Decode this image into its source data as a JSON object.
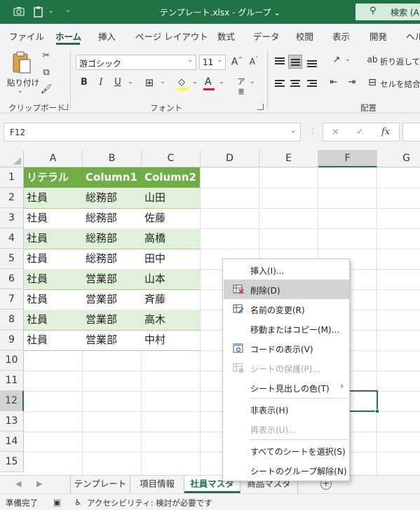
{
  "titlebar": {
    "title": "テンプレート.xlsx  -  グループ ⌄",
    "search_label": "検索 (A"
  },
  "ribbon": {
    "tabs": [
      "ファイル",
      "ホーム",
      "挿入",
      "ページ レイアウト",
      "数式",
      "データ",
      "校閲",
      "表示",
      "開発",
      "ヘル"
    ],
    "active_tab": "ホーム",
    "clipboard": {
      "paste_label": "貼り付け",
      "group_label": "クリップボード"
    },
    "font": {
      "name": "游ゴシック",
      "size": "11",
      "group_label": "フォント",
      "grow": "A^",
      "shrink": "Aˇ"
    },
    "alignment": {
      "wrap_label": "折り返して全",
      "merge_label": "セルを結合",
      "group_label": "配置"
    }
  },
  "formula_bar": {
    "name_box": "F12",
    "fx": "fx",
    "cancel": "×",
    "enter": "✓"
  },
  "grid": {
    "columns": [
      "A",
      "B",
      "C",
      "D",
      "E",
      "F",
      "G"
    ],
    "selected_column": "F",
    "rows": [
      "1",
      "2",
      "3",
      "4",
      "5",
      "6",
      "7",
      "8",
      "9",
      "10",
      "11",
      "12",
      "13",
      "14",
      "15"
    ],
    "selected_row": "12",
    "table": {
      "headers": [
        "リテラル",
        "Column1",
        "Column2"
      ],
      "rows": [
        [
          "社員",
          "総務部",
          "山田"
        ],
        [
          "社員",
          "総務部",
          "佐藤"
        ],
        [
          "社員",
          "総務部",
          "高橋"
        ],
        [
          "社員",
          "総務部",
          "田中"
        ],
        [
          "社員",
          "営業部",
          "山本"
        ],
        [
          "社員",
          "営業部",
          "斉藤"
        ],
        [
          "社員",
          "営業部",
          "高木"
        ],
        [
          "社員",
          "営業部",
          "中村"
        ]
      ],
      "header_color": "#70ad47",
      "band_color": "#e2efda"
    }
  },
  "sheets": {
    "tabs": [
      "テンプレート",
      "項目情報",
      "社員マスタ",
      "商品マスタ"
    ],
    "active": "社員マスタ",
    "add_label": "+"
  },
  "status": {
    "ready": "準備完了",
    "accessibility": "アクセシビリティ: 検討が必要です"
  },
  "context_menu": {
    "items": [
      {
        "label": "挿入(I)...",
        "disabled": false
      },
      {
        "label": "削除(D)",
        "disabled": false,
        "highlighted": true
      },
      {
        "label": "名前の変更(R)",
        "disabled": false
      },
      {
        "label": "移動またはコピー(M)...",
        "disabled": false
      },
      {
        "label": "コードの表示(V)",
        "disabled": false
      },
      {
        "label": "シートの保護(P)...",
        "disabled": true
      },
      {
        "label": "シート見出しの色(T)",
        "disabled": false,
        "submenu": true
      },
      {
        "label": "非表示(H)",
        "disabled": false
      },
      {
        "label": "再表示(U)...",
        "disabled": true
      },
      {
        "label": "すべてのシートを選択(S)",
        "disabled": false
      },
      {
        "label": "シートのグループ解除(N)",
        "disabled": false
      }
    ]
  },
  "colors": {
    "accent": "#217346",
    "table_green": "#70ad47",
    "band_green": "#e2efda"
  }
}
